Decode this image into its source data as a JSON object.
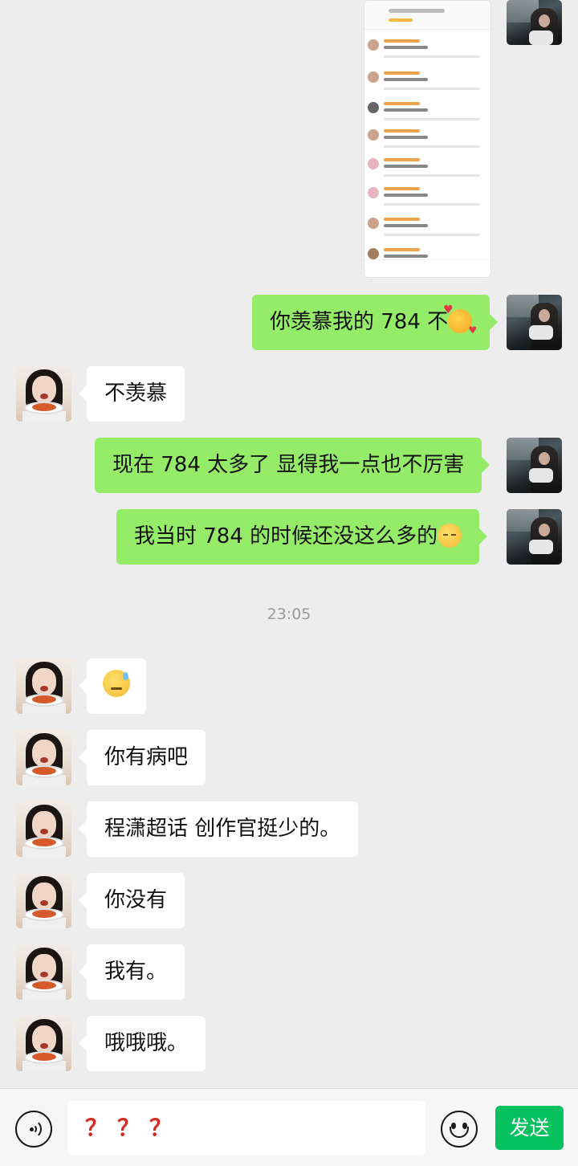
{
  "messages": [
    {
      "side": "me",
      "type": "image",
      "label": ""
    },
    {
      "side": "me",
      "type": "text",
      "text": "你羡慕我的 784 不",
      "emoji": "smiling-face-with-hearts-icon"
    },
    {
      "side": "her",
      "type": "text",
      "text": "不羡慕"
    },
    {
      "side": "me",
      "type": "text",
      "text": "现在 784 太多了 显得我一点也不厉害"
    },
    {
      "side": "me",
      "type": "text",
      "text": "我当时 784 的时候还没这么多的",
      "emoji": "pensive-face-icon"
    },
    {
      "side": "her",
      "type": "emoji",
      "emoji": "anxious-sweat-face-icon"
    },
    {
      "side": "her",
      "type": "text",
      "text": "你有病吧"
    },
    {
      "side": "her",
      "type": "text",
      "text": "程潇超话 创作官挺少的。"
    },
    {
      "side": "her",
      "type": "text",
      "text": "你没有"
    },
    {
      "side": "her",
      "type": "text",
      "text": "我有。"
    },
    {
      "side": "her",
      "type": "text",
      "text": "哦哦哦。"
    }
  ],
  "timestamp": "23:05",
  "input": {
    "value": "？？？",
    "send_label": "发送"
  },
  "colors": {
    "my_bubble": "#95ec69",
    "her_bubble": "#ffffff",
    "send_button": "#07c160",
    "background": "#ededed",
    "input_text": "#d42a1f"
  }
}
